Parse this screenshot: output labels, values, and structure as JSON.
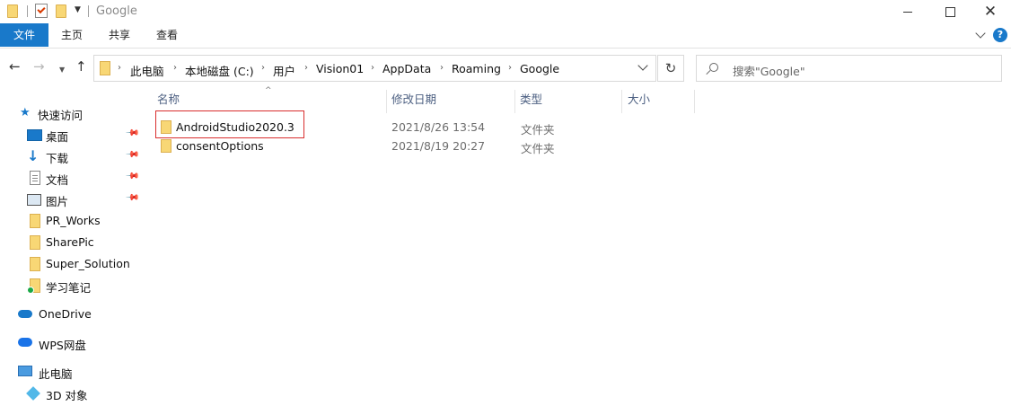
{
  "window": {
    "title": "Google"
  },
  "ribbon": {
    "file_tab": "文件",
    "tabs": [
      "主页",
      "共享",
      "查看"
    ],
    "help_label": "?"
  },
  "controls": {
    "minimize": "",
    "maximize": "",
    "close": "✕"
  },
  "address": {
    "breadcrumbs": [
      "此电脑",
      "本地磁盘 (C:)",
      "用户",
      "Vision01",
      "AppData",
      "Roaming",
      "Google"
    ]
  },
  "search": {
    "placeholder": "搜索\"Google\""
  },
  "columns": {
    "name": "名称",
    "modified": "修改日期",
    "type": "类型",
    "size": "大小"
  },
  "files": [
    {
      "name": "AndroidStudio2020.3",
      "modified": "2021/8/26 13:54",
      "type": "文件夹",
      "selected_outline": true
    },
    {
      "name": "consentOptions",
      "modified": "2021/8/19 20:27",
      "type": "文件夹",
      "selected_outline": false
    }
  ],
  "nav_pane": {
    "quick_access": "快速访问",
    "items": [
      {
        "label": "桌面",
        "icon": "desktop-icon",
        "pinned": true
      },
      {
        "label": "下载",
        "icon": "download-icon",
        "pinned": true
      },
      {
        "label": "文档",
        "icon": "document-icon",
        "pinned": true
      },
      {
        "label": "图片",
        "icon": "pictures-icon",
        "pinned": true
      },
      {
        "label": "PR_Works",
        "icon": "folder-icon",
        "pinned": false
      },
      {
        "label": "SharePic",
        "icon": "folder-icon",
        "pinned": false
      },
      {
        "label": "Super_Solution",
        "icon": "folder-icon",
        "pinned": false
      },
      {
        "label": "学习笔记",
        "icon": "folder-sync-icon",
        "pinned": false
      }
    ],
    "onedrive": "OneDrive",
    "wps": "WPS网盘",
    "this_pc": "此电脑",
    "objects_3d": "3D 对象"
  },
  "colors": {
    "accent": "#1979ca",
    "folder": "#f8d775",
    "highlight_border": "#d92e2e"
  }
}
